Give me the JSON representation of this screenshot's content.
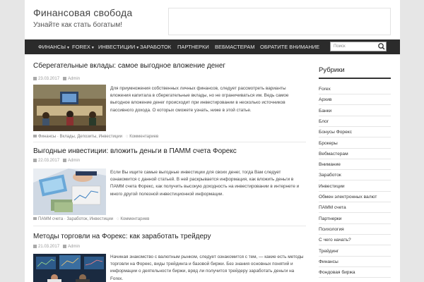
{
  "site": {
    "title": "Финансовая свобода",
    "description": "Узнайте как стать богатым!"
  },
  "nav": {
    "items": [
      {
        "label": "ФИНАНСЫ",
        "dropdown": true
      },
      {
        "label": "FOREX",
        "dropdown": true
      },
      {
        "label": "ИНВЕСТИЦИИ",
        "dropdown": true
      },
      {
        "label": "ЗАРАБОТОК",
        "dropdown": false
      },
      {
        "label": "ПАРТНЕРКИ",
        "dropdown": false
      },
      {
        "label": "ВЕБМАСТЕРАМ",
        "dropdown": false
      },
      {
        "label": "ОБРАТИТЕ ВНИМАНИЕ",
        "dropdown": false
      }
    ],
    "search_placeholder": "Поиск"
  },
  "posts": [
    {
      "title": "Сберегательные вклады: самое выгодное вложение денег",
      "date": "23.03.2017",
      "author": "Admin",
      "excerpt": "Для приумножения собственных личных финансов, следует рассмотреть варианты вложения капитала в сберегательные вклады, но не ограничиваться им. Ведь самое выгодное вложение денег происходит при инвестировании в несколько источников пассивного дохода. О которых сможете узнать, ниже в этой статье.",
      "categories": "Финансы · Вклады, Депозиты, Инвестиции",
      "comments": "Комментариев"
    },
    {
      "title": "Выгодные инвестиции: вложить деньги в ПАММ счета Форекс",
      "date": "22.03.2017",
      "author": "Admin",
      "excerpt": "Если Вы ищите самые выгодные инвестиции для своих денег, тогда Вам следует ознакомится с данной статьей. В ней раскрывается информация, как вложить деньги в ПАММ счета Форекс, как получить высокую доходность на инвестировании в интернете и много другой полезной инвестиционной информации.",
      "categories": "ПАММ счета · Заработок, Инвестиции",
      "comments": "Комментариев"
    },
    {
      "title": "Методы торговли на Форекс: как заработать трейдеру",
      "date": "21.03.2017",
      "author": "Admin",
      "excerpt": "Начиная знакомство с валютным рынком, следует ознакомится с тем, — какие есть методы торговли на Форекс, виды трейдинга и базовой биржи. Без знания основных понятий и информации о деятельности биржи, вряд ли получится трейдеру заработать деньги на Forex.",
      "categories": "",
      "comments": ""
    }
  ],
  "sidebar": {
    "title": "Рубрики",
    "items": [
      "Forex",
      "Архив",
      "Банки",
      "Блог",
      "Бонусы Форекс",
      "Брокеры",
      "Вебмастерам",
      "Внимание",
      "Заработок",
      "Инвестиции",
      "Обмен электронных валют",
      "ПАММ счета",
      "Партнерки",
      "Психология",
      "С чего начать?",
      "Трейдинг",
      "Финансы",
      "Фондовая биржа"
    ]
  },
  "colors": {
    "nav_bg": "#2b2b2b",
    "page_bg": "#e6e6e6"
  }
}
